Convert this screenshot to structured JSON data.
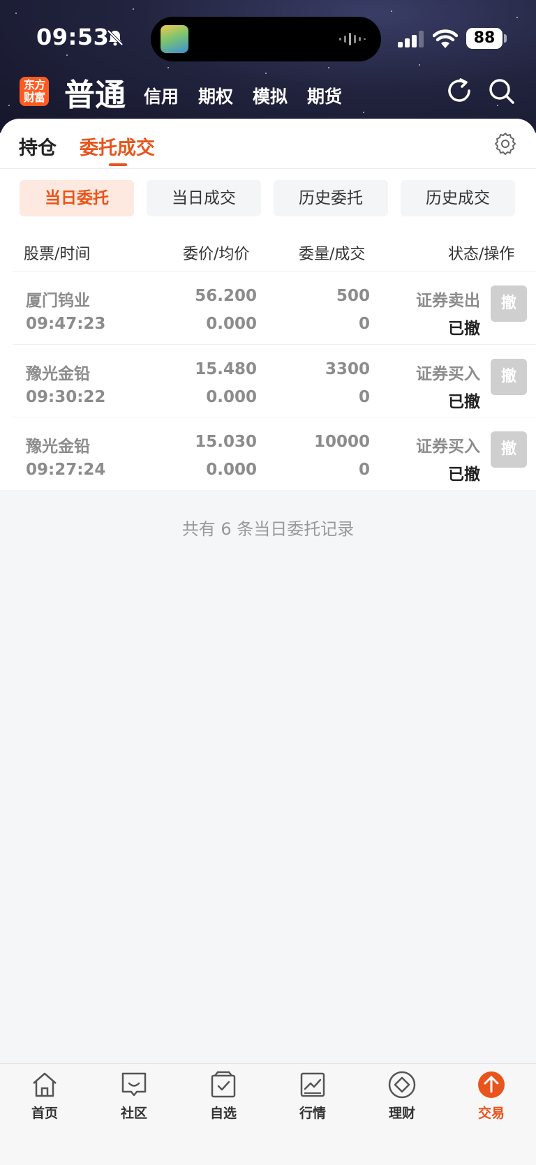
{
  "status_bar": {
    "time": "09:53",
    "battery": "88"
  },
  "header": {
    "brand_logo_text": [
      "东方",
      "财富"
    ],
    "active_mode": "普通",
    "modes": [
      "信用",
      "期权",
      "模拟",
      "期货"
    ],
    "icons": [
      "refresh-icon",
      "search-icon"
    ]
  },
  "tabs": {
    "holdings": "持仓",
    "orders": "委托成交",
    "active": "委托成交"
  },
  "subtabs": [
    {
      "label": "当日委托",
      "active": true
    },
    {
      "label": "当日成交",
      "active": false
    },
    {
      "label": "历史委托",
      "active": false
    },
    {
      "label": "历史成交",
      "active": false
    }
  ],
  "table": {
    "headers": {
      "stock_time": "股票/时间",
      "price": "委价/均价",
      "volume": "委量/成交",
      "status": "状态/操作"
    },
    "rows": [
      {
        "name": "厦门钨业",
        "time": "09:47:23",
        "order_price": "56.200",
        "avg_price": "0.000",
        "order_qty": "500",
        "filled_qty": "0",
        "direction": "证券卖出",
        "status": "已撤",
        "action": "撤"
      },
      {
        "name": "豫光金铅",
        "time": "09:30:22",
        "order_price": "15.480",
        "avg_price": "0.000",
        "order_qty": "3300",
        "filled_qty": "0",
        "direction": "证券买入",
        "status": "已撤",
        "action": "撤"
      },
      {
        "name": "豫光金铅",
        "time": "09:27:24",
        "order_price": "15.030",
        "avg_price": "0.000",
        "order_qty": "10000",
        "filled_qty": "0",
        "direction": "证券买入",
        "status": "已撤",
        "action": "撤"
      }
    ]
  },
  "footer_note": "共有 6 条当日委托记录",
  "bottom_nav": [
    {
      "label": "首页",
      "icon": "home-icon",
      "active": false
    },
    {
      "label": "社区",
      "icon": "chat-icon",
      "active": false
    },
    {
      "label": "自选",
      "icon": "watchlist-icon",
      "active": false
    },
    {
      "label": "行情",
      "icon": "chart-icon",
      "active": false
    },
    {
      "label": "理财",
      "icon": "finance-diamond-icon",
      "active": false
    },
    {
      "label": "交易",
      "icon": "trade-arrow-icon",
      "active": true
    }
  ],
  "colors": {
    "accent": "#e8541c",
    "header_bg": "#22243f",
    "brand_orange": "#ff5b21"
  }
}
